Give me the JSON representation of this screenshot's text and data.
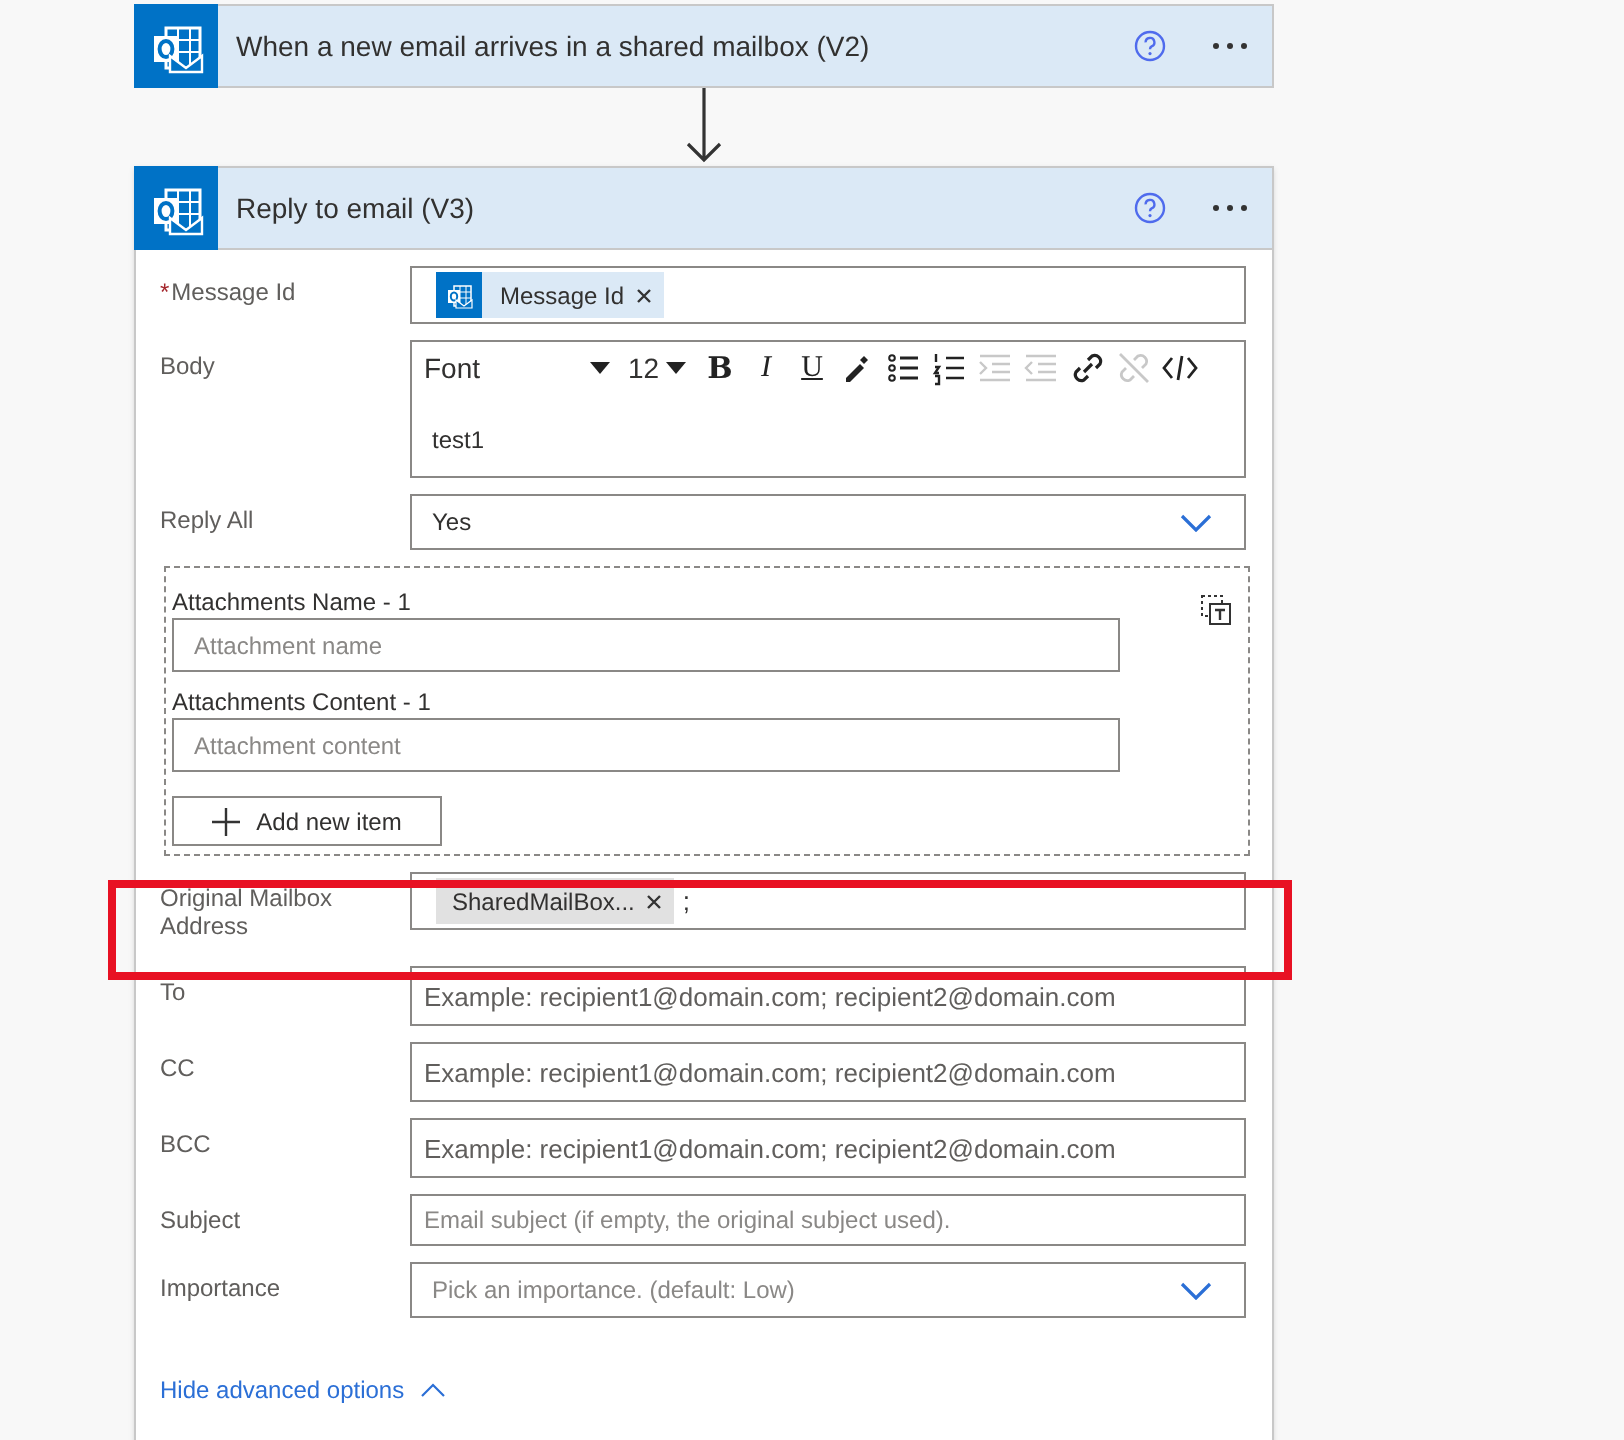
{
  "trigger": {
    "title": "When a new email arrives in a shared mailbox (V2)"
  },
  "action": {
    "title": "Reply to email (V3)",
    "fields": [
      {
        "kind": "token",
        "label": "Message Id",
        "required_mark": "*",
        "tokens": [
          {
            "text": "Message Id",
            "icon": true
          }
        ]
      },
      {
        "kind": "richtext",
        "label": "Body",
        "font": "Font",
        "size": "12",
        "value": "test1",
        "tools": [
          {
            "kind": "bold",
            "text": "B",
            "disabled": false
          },
          {
            "kind": "italic",
            "text": "I",
            "disabled": false
          },
          {
            "kind": "underline",
            "text": "U",
            "disabled": false
          },
          {
            "kind": "color",
            "disabled": false
          },
          {
            "kind": "bullets",
            "disabled": false
          },
          {
            "kind": "numbers",
            "disabled": false
          },
          {
            "kind": "indent",
            "disabled": true
          },
          {
            "kind": "outdent",
            "disabled": true
          },
          {
            "kind": "link",
            "disabled": false
          },
          {
            "kind": "unlink",
            "disabled": true
          },
          {
            "kind": "code",
            "disabled": false
          }
        ]
      },
      {
        "kind": "dropdown",
        "label": "Reply All",
        "value": "Yes"
      },
      {
        "kind": "array",
        "items": [
          {
            "label": "Attachments Name - 1",
            "placeholder": "Attachment name"
          },
          {
            "label": "Attachments Content - 1",
            "placeholder": "Attachment content"
          }
        ],
        "add_label": "Add new item"
      },
      {
        "kind": "token",
        "label": "Original Mailbox Address",
        "highlighted": true,
        "tokens": [
          {
            "text": "SharedMailBox...",
            "icon": false
          }
        ],
        "suffix": ";"
      },
      {
        "kind": "text",
        "label": "To",
        "placeholder": "Example: recipient1@domain.com; recipient2@domain.com"
      },
      {
        "kind": "text",
        "label": "CC",
        "placeholder": "Example: recipient1@domain.com; recipient2@domain.com"
      },
      {
        "kind": "text",
        "label": "BCC",
        "placeholder": "Example: recipient1@domain.com; recipient2@domain.com"
      },
      {
        "kind": "text",
        "label": "Subject",
        "small": true,
        "placeholder": "Email subject (if empty, the original subject used)."
      },
      {
        "kind": "dropdown",
        "label": "Importance",
        "placeholder": "Pick an importance. (default: Low)"
      }
    ],
    "advanced_link": "Hide advanced options"
  }
}
